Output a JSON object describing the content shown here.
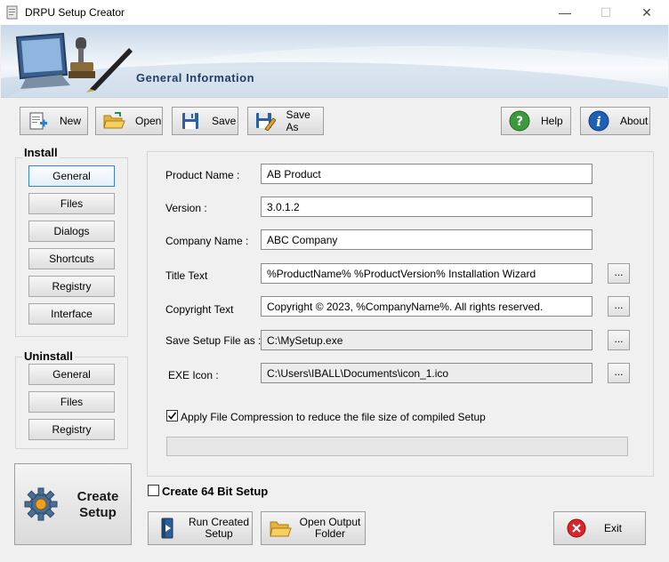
{
  "window": {
    "title": "DRPU Setup Creator",
    "minimize_glyph": "—",
    "maximize_glyph": "☐",
    "close_glyph": "✕"
  },
  "banner": {
    "title": "General Information"
  },
  "toolbar": {
    "new_label": "New",
    "open_label": "Open",
    "save_label": "Save",
    "save_as_label": "Save As",
    "help_label": "Help",
    "about_label": "About"
  },
  "install": {
    "heading": "Install",
    "items": [
      "General",
      "Files",
      "Dialogs",
      "Shortcuts",
      "Registry",
      "Interface"
    ],
    "active": "General"
  },
  "uninstall": {
    "heading": "Uninstall",
    "items": [
      "General",
      "Files",
      "Registry"
    ]
  },
  "create_setup": {
    "line1": "Create",
    "line2": "Setup"
  },
  "form": {
    "product_name": {
      "label": "Product Name :",
      "value": "AB Product"
    },
    "version": {
      "label": "Version :",
      "value": "3.0.1.2"
    },
    "company_name": {
      "label": "Company Name :",
      "value": "ABC Company"
    },
    "title_text": {
      "label": "Title Text",
      "value": "%ProductName% %ProductVersion% Installation Wizard"
    },
    "copyright_text": {
      "label": "Copyright Text",
      "value": "Copyright © 2023, %CompanyName%. All rights reserved."
    },
    "save_setup": {
      "label": "Save Setup File as :",
      "value": "C:\\MySetup.exe"
    },
    "exe_icon": {
      "label": "EXE Icon :",
      "value": "C:\\Users\\IBALL\\Documents\\icon_1.ico"
    },
    "browse_label": "...",
    "compression": {
      "label": "Apply File Compression to reduce the file size of compiled Setup",
      "checked": true
    },
    "progress_fraction": 0
  },
  "create_64bit": {
    "label": "Create 64 Bit Setup",
    "checked": false
  },
  "bottom": {
    "run_line1": "Run Created",
    "run_line2": "Setup",
    "open_line1": "Open Output",
    "open_line2": "Folder",
    "exit_label": "Exit"
  },
  "colors": {
    "banner_title": "#1f3e66",
    "active_border": "#3b7fcf",
    "exit_red": "#d8262b",
    "help_green": "#3c9a3c",
    "about_blue": "#1f5fb5"
  }
}
